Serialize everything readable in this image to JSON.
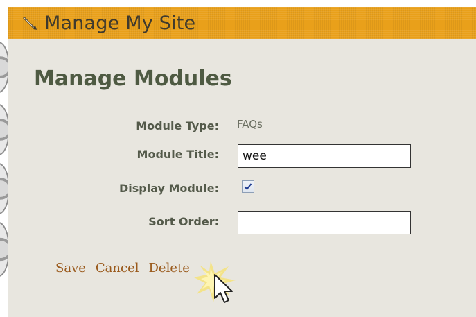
{
  "header": {
    "title": "Manage My Site",
    "icon": "pencil-icon",
    "background_color": "#e9a01a"
  },
  "main": {
    "section_title": "Manage Modules",
    "fields": {
      "module_type": {
        "label": "Module Type:",
        "value": "FAQs"
      },
      "module_title": {
        "label": "Module Title:",
        "value": "wee"
      },
      "display_module": {
        "label": "Display Module:",
        "checked": true
      },
      "sort_order": {
        "label": "Sort Order:",
        "value": ""
      }
    },
    "actions": {
      "save_label": "Save",
      "cancel_label": "Cancel",
      "delete_label": "Delete"
    }
  },
  "colors": {
    "panel_background": "#e8e6df",
    "link_color": "#9a5a1c",
    "label_color": "#545a4a",
    "title_color": "#4e5a42"
  },
  "cursor": {
    "icon": "mouse-pointer-icon",
    "highlight": "click-burst-icon"
  }
}
